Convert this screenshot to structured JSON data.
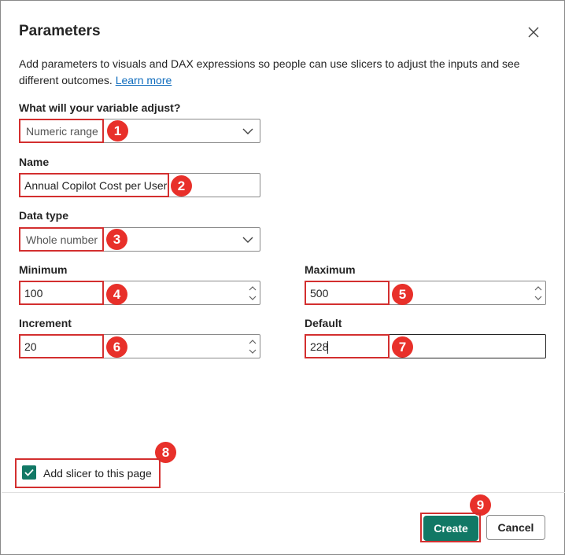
{
  "dialog": {
    "title": "Parameters",
    "description": "Add parameters to visuals and DAX expressions so people can use slicers to adjust the inputs and see different outcomes.",
    "learn_more": "Learn more"
  },
  "fields": {
    "variable": {
      "label": "What will your variable adjust?",
      "value": "Numeric range"
    },
    "name": {
      "label": "Name",
      "value": "Annual Copilot Cost per User"
    },
    "data_type": {
      "label": "Data type",
      "value": "Whole number"
    },
    "minimum": {
      "label": "Minimum",
      "value": "100"
    },
    "maximum": {
      "label": "Maximum",
      "value": "500"
    },
    "increment": {
      "label": "Increment",
      "value": "20"
    },
    "default": {
      "label": "Default",
      "value": "228"
    }
  },
  "slicer": {
    "label": "Add slicer to this page",
    "checked": true
  },
  "buttons": {
    "create": "Create",
    "cancel": "Cancel"
  },
  "annotations": [
    "1",
    "2",
    "3",
    "4",
    "5",
    "6",
    "7",
    "8",
    "9"
  ],
  "colors": {
    "accent": "#117865",
    "highlight": "#d32f2f",
    "badge": "#e8302a",
    "link": "#0f6cbd"
  }
}
